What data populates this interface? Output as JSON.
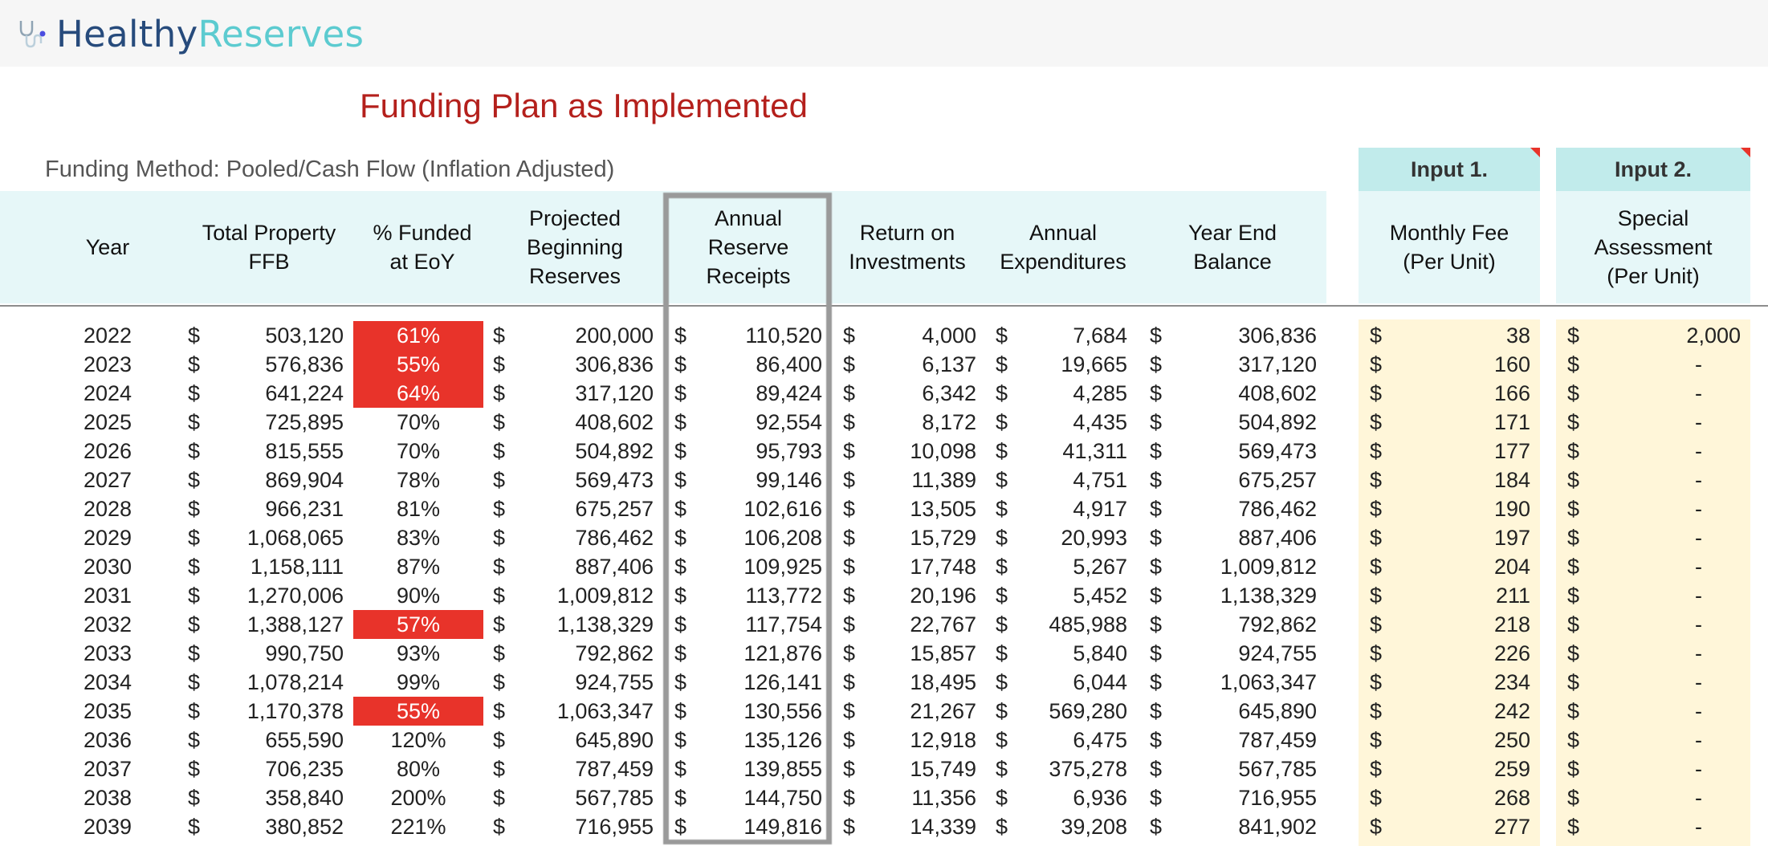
{
  "app": {
    "brand_part1": "Healthy",
    "brand_part2": "Reserves",
    "logo_icon": "stethoscope-icon"
  },
  "page": {
    "title": "Funding Plan as Implemented",
    "funding_method": "Funding Method:  Pooled/Cash Flow (Inflation Adjusted)"
  },
  "colors": {
    "title": "#b4201c",
    "underfunded_highlight": "#e8332a",
    "header_band": "#e6f7f8",
    "input_tab": "#c1ebeb",
    "input_column": "#fff6d9"
  },
  "inputs": {
    "input1_label": "Input 1.",
    "input2_label": "Input 2."
  },
  "table": {
    "headers": {
      "year": "Year",
      "ffb": "Total Property\nFFB",
      "pct": "% Funded\nat EoY",
      "begin": "Projected\nBeginning\nReserves",
      "receipts": "Annual\nReserve\nReceipts",
      "roi": "Return on\nInvestments",
      "exp": "Annual\nExpenditures",
      "end": "Year End\nBalance",
      "fee": "Monthly Fee\n(Per Unit)",
      "special": "Special\nAssessment\n(Per Unit)"
    },
    "currency_symbol": "$",
    "rows": [
      {
        "year": "2022",
        "ffb": "503,120",
        "pct": "61%",
        "pct_flag": true,
        "begin": "200,000",
        "receipts": "110,520",
        "roi": "4,000",
        "exp": "7,684",
        "end": "306,836",
        "fee": "38",
        "special": "2,000"
      },
      {
        "year": "2023",
        "ffb": "576,836",
        "pct": "55%",
        "pct_flag": true,
        "begin": "306,836",
        "receipts": "86,400",
        "roi": "6,137",
        "exp": "19,665",
        "end": "317,120",
        "fee": "160",
        "special": "-"
      },
      {
        "year": "2024",
        "ffb": "641,224",
        "pct": "64%",
        "pct_flag": true,
        "begin": "317,120",
        "receipts": "89,424",
        "roi": "6,342",
        "exp": "4,285",
        "end": "408,602",
        "fee": "166",
        "special": "-"
      },
      {
        "year": "2025",
        "ffb": "725,895",
        "pct": "70%",
        "pct_flag": false,
        "begin": "408,602",
        "receipts": "92,554",
        "roi": "8,172",
        "exp": "4,435",
        "end": "504,892",
        "fee": "171",
        "special": "-"
      },
      {
        "year": "2026",
        "ffb": "815,555",
        "pct": "70%",
        "pct_flag": false,
        "begin": "504,892",
        "receipts": "95,793",
        "roi": "10,098",
        "exp": "41,311",
        "end": "569,473",
        "fee": "177",
        "special": "-"
      },
      {
        "year": "2027",
        "ffb": "869,904",
        "pct": "78%",
        "pct_flag": false,
        "begin": "569,473",
        "receipts": "99,146",
        "roi": "11,389",
        "exp": "4,751",
        "end": "675,257",
        "fee": "184",
        "special": "-"
      },
      {
        "year": "2028",
        "ffb": "966,231",
        "pct": "81%",
        "pct_flag": false,
        "begin": "675,257",
        "receipts": "102,616",
        "roi": "13,505",
        "exp": "4,917",
        "end": "786,462",
        "fee": "190",
        "special": "-"
      },
      {
        "year": "2029",
        "ffb": "1,068,065",
        "pct": "83%",
        "pct_flag": false,
        "begin": "786,462",
        "receipts": "106,208",
        "roi": "15,729",
        "exp": "20,993",
        "end": "887,406",
        "fee": "197",
        "special": "-"
      },
      {
        "year": "2030",
        "ffb": "1,158,111",
        "pct": "87%",
        "pct_flag": false,
        "begin": "887,406",
        "receipts": "109,925",
        "roi": "17,748",
        "exp": "5,267",
        "end": "1,009,812",
        "fee": "204",
        "special": "-"
      },
      {
        "year": "2031",
        "ffb": "1,270,006",
        "pct": "90%",
        "pct_flag": false,
        "begin": "1,009,812",
        "receipts": "113,772",
        "roi": "20,196",
        "exp": "5,452",
        "end": "1,138,329",
        "fee": "211",
        "special": "-"
      },
      {
        "year": "2032",
        "ffb": "1,388,127",
        "pct": "57%",
        "pct_flag": true,
        "begin": "1,138,329",
        "receipts": "117,754",
        "roi": "22,767",
        "exp": "485,988",
        "end": "792,862",
        "fee": "218",
        "special": "-"
      },
      {
        "year": "2033",
        "ffb": "990,750",
        "pct": "93%",
        "pct_flag": false,
        "begin": "792,862",
        "receipts": "121,876",
        "roi": "15,857",
        "exp": "5,840",
        "end": "924,755",
        "fee": "226",
        "special": "-"
      },
      {
        "year": "2034",
        "ffb": "1,078,214",
        "pct": "99%",
        "pct_flag": false,
        "begin": "924,755",
        "receipts": "126,141",
        "roi": "18,495",
        "exp": "6,044",
        "end": "1,063,347",
        "fee": "234",
        "special": "-"
      },
      {
        "year": "2035",
        "ffb": "1,170,378",
        "pct": "55%",
        "pct_flag": true,
        "begin": "1,063,347",
        "receipts": "130,556",
        "roi": "21,267",
        "exp": "569,280",
        "end": "645,890",
        "fee": "242",
        "special": "-"
      },
      {
        "year": "2036",
        "ffb": "655,590",
        "pct": "120%",
        "pct_flag": false,
        "begin": "645,890",
        "receipts": "135,126",
        "roi": "12,918",
        "exp": "6,475",
        "end": "787,459",
        "fee": "250",
        "special": "-"
      },
      {
        "year": "2037",
        "ffb": "706,235",
        "pct": "80%",
        "pct_flag": false,
        "begin": "787,459",
        "receipts": "139,855",
        "roi": "15,749",
        "exp": "375,278",
        "end": "567,785",
        "fee": "259",
        "special": "-"
      },
      {
        "year": "2038",
        "ffb": "358,840",
        "pct": "200%",
        "pct_flag": false,
        "begin": "567,785",
        "receipts": "144,750",
        "roi": "11,356",
        "exp": "6,936",
        "end": "716,955",
        "fee": "268",
        "special": "-"
      },
      {
        "year": "2039",
        "ffb": "380,852",
        "pct": "221%",
        "pct_flag": false,
        "begin": "716,955",
        "receipts": "149,816",
        "roi": "14,339",
        "exp": "39,208",
        "end": "841,902",
        "fee": "277",
        "special": "-"
      }
    ]
  }
}
